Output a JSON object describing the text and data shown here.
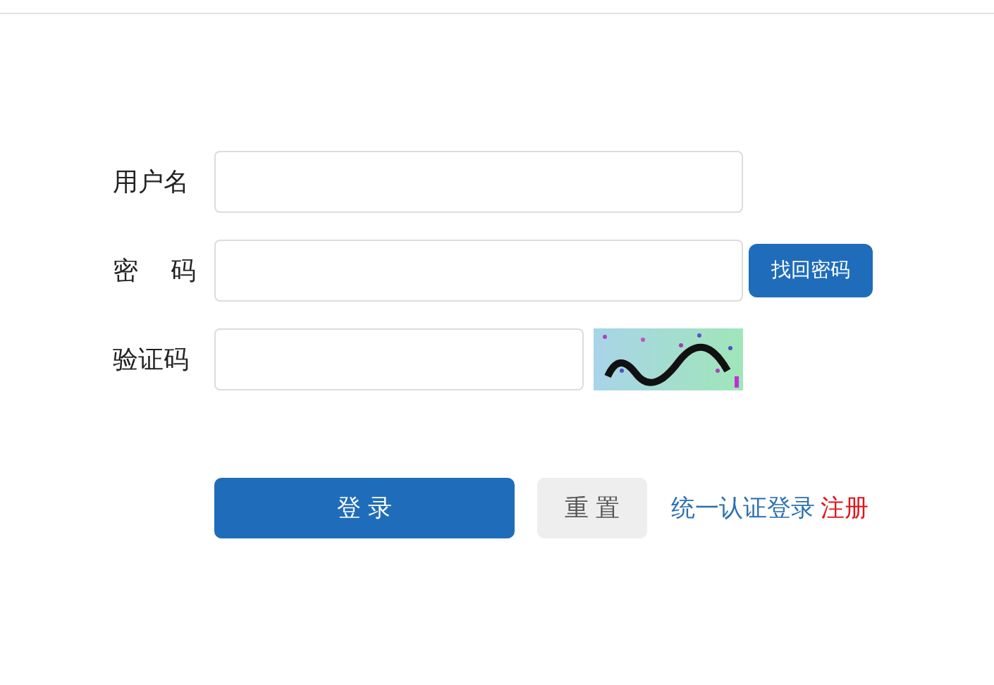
{
  "fields": [
    {
      "label": "用户名",
      "kind": "text"
    },
    {
      "label": "密　码",
      "kind": "password",
      "action": "找回密码"
    },
    {
      "label": "验证码",
      "kind": "captcha"
    }
  ],
  "buttons": [
    {
      "label": "登 录",
      "kind": "primary"
    },
    {
      "label": "重 置",
      "kind": "secondary"
    }
  ],
  "links": [
    {
      "label": "统一认证登录",
      "kind": "normal"
    },
    {
      "label": "注册",
      "kind": "danger"
    }
  ]
}
